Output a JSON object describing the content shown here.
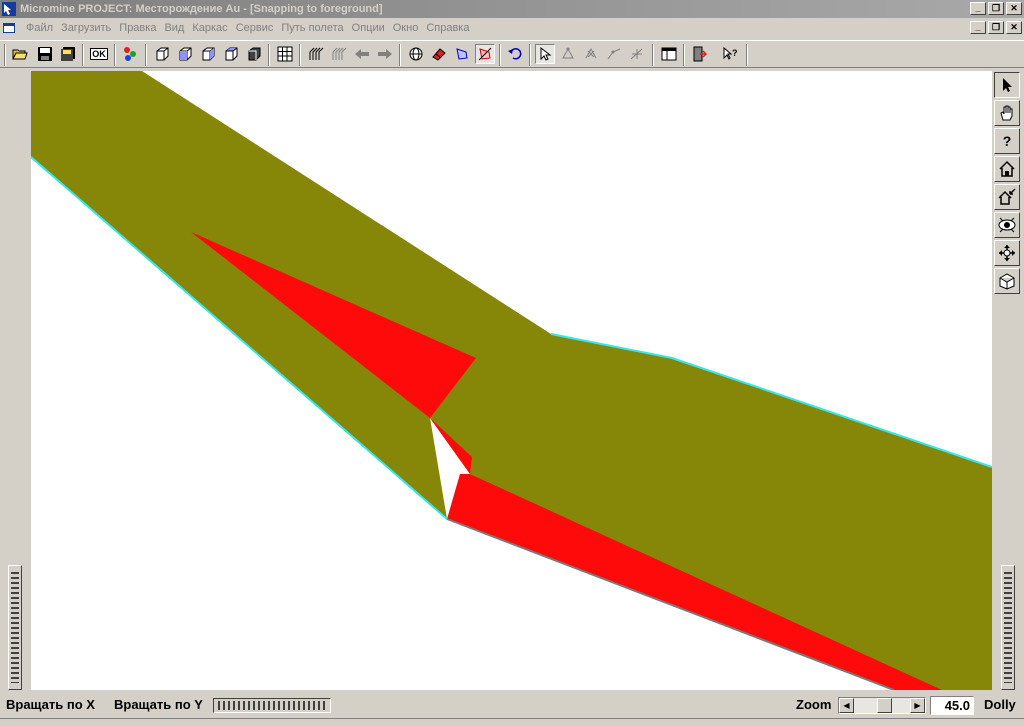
{
  "window": {
    "title": "Micromine    PROJECT: Месторождение Au - [Snapping to foreground]",
    "minimize_glyph": "_",
    "restore_glyph": "❐",
    "close_glyph": "✕"
  },
  "menu": {
    "items": [
      "Файл",
      "Загрузить",
      "Правка",
      "Вид",
      "Каркас",
      "Сервис",
      "Путь полета",
      "Опции",
      "Окно",
      "Справка"
    ]
  },
  "toolbar": {
    "ok_label": "OK",
    "tools": [
      "open-folder-icon",
      "save-icon",
      "save-all-icon",
      "ok-button",
      "properties-icon",
      "cube-front-icon",
      "cube-side-icon",
      "cube-top-icon",
      "cube-iso-icon",
      "cube-solid-icon",
      "grid-icon",
      "layers-icon",
      "layers-alt-icon",
      "arrow-left-icon",
      "arrow-right-icon",
      "globe-icon",
      "eraser-icon",
      "select-shape-icon",
      "select-cross-icon",
      "undo-icon",
      "pointer-icon",
      "vertex-move-icon",
      "vertex-delete-icon",
      "vertex-add-icon",
      "vertex-insert-icon",
      "window-icon",
      "exit-icon",
      "help-pointer-icon"
    ]
  },
  "side_tools": [
    "pointer-icon",
    "hand-icon",
    "help-icon",
    "home-icon",
    "home-zoom-icon",
    "eye-icon",
    "move-icon",
    "box-icon"
  ],
  "side_help_glyph": "?",
  "status": {
    "rotate_x_label": "Вращать по  X",
    "rotate_y_label": "Вращать по Y",
    "zoom_label": "Zoom",
    "zoom_value": "45.0",
    "dolly_label": "Dolly",
    "zoom_left_glyph": "◀",
    "zoom_right_glyph": "▶"
  },
  "colors": {
    "surface": "#868609",
    "highlight": "#ff0a0a",
    "edge": "#34e8e8",
    "viewport_bg": "#ffffff"
  }
}
